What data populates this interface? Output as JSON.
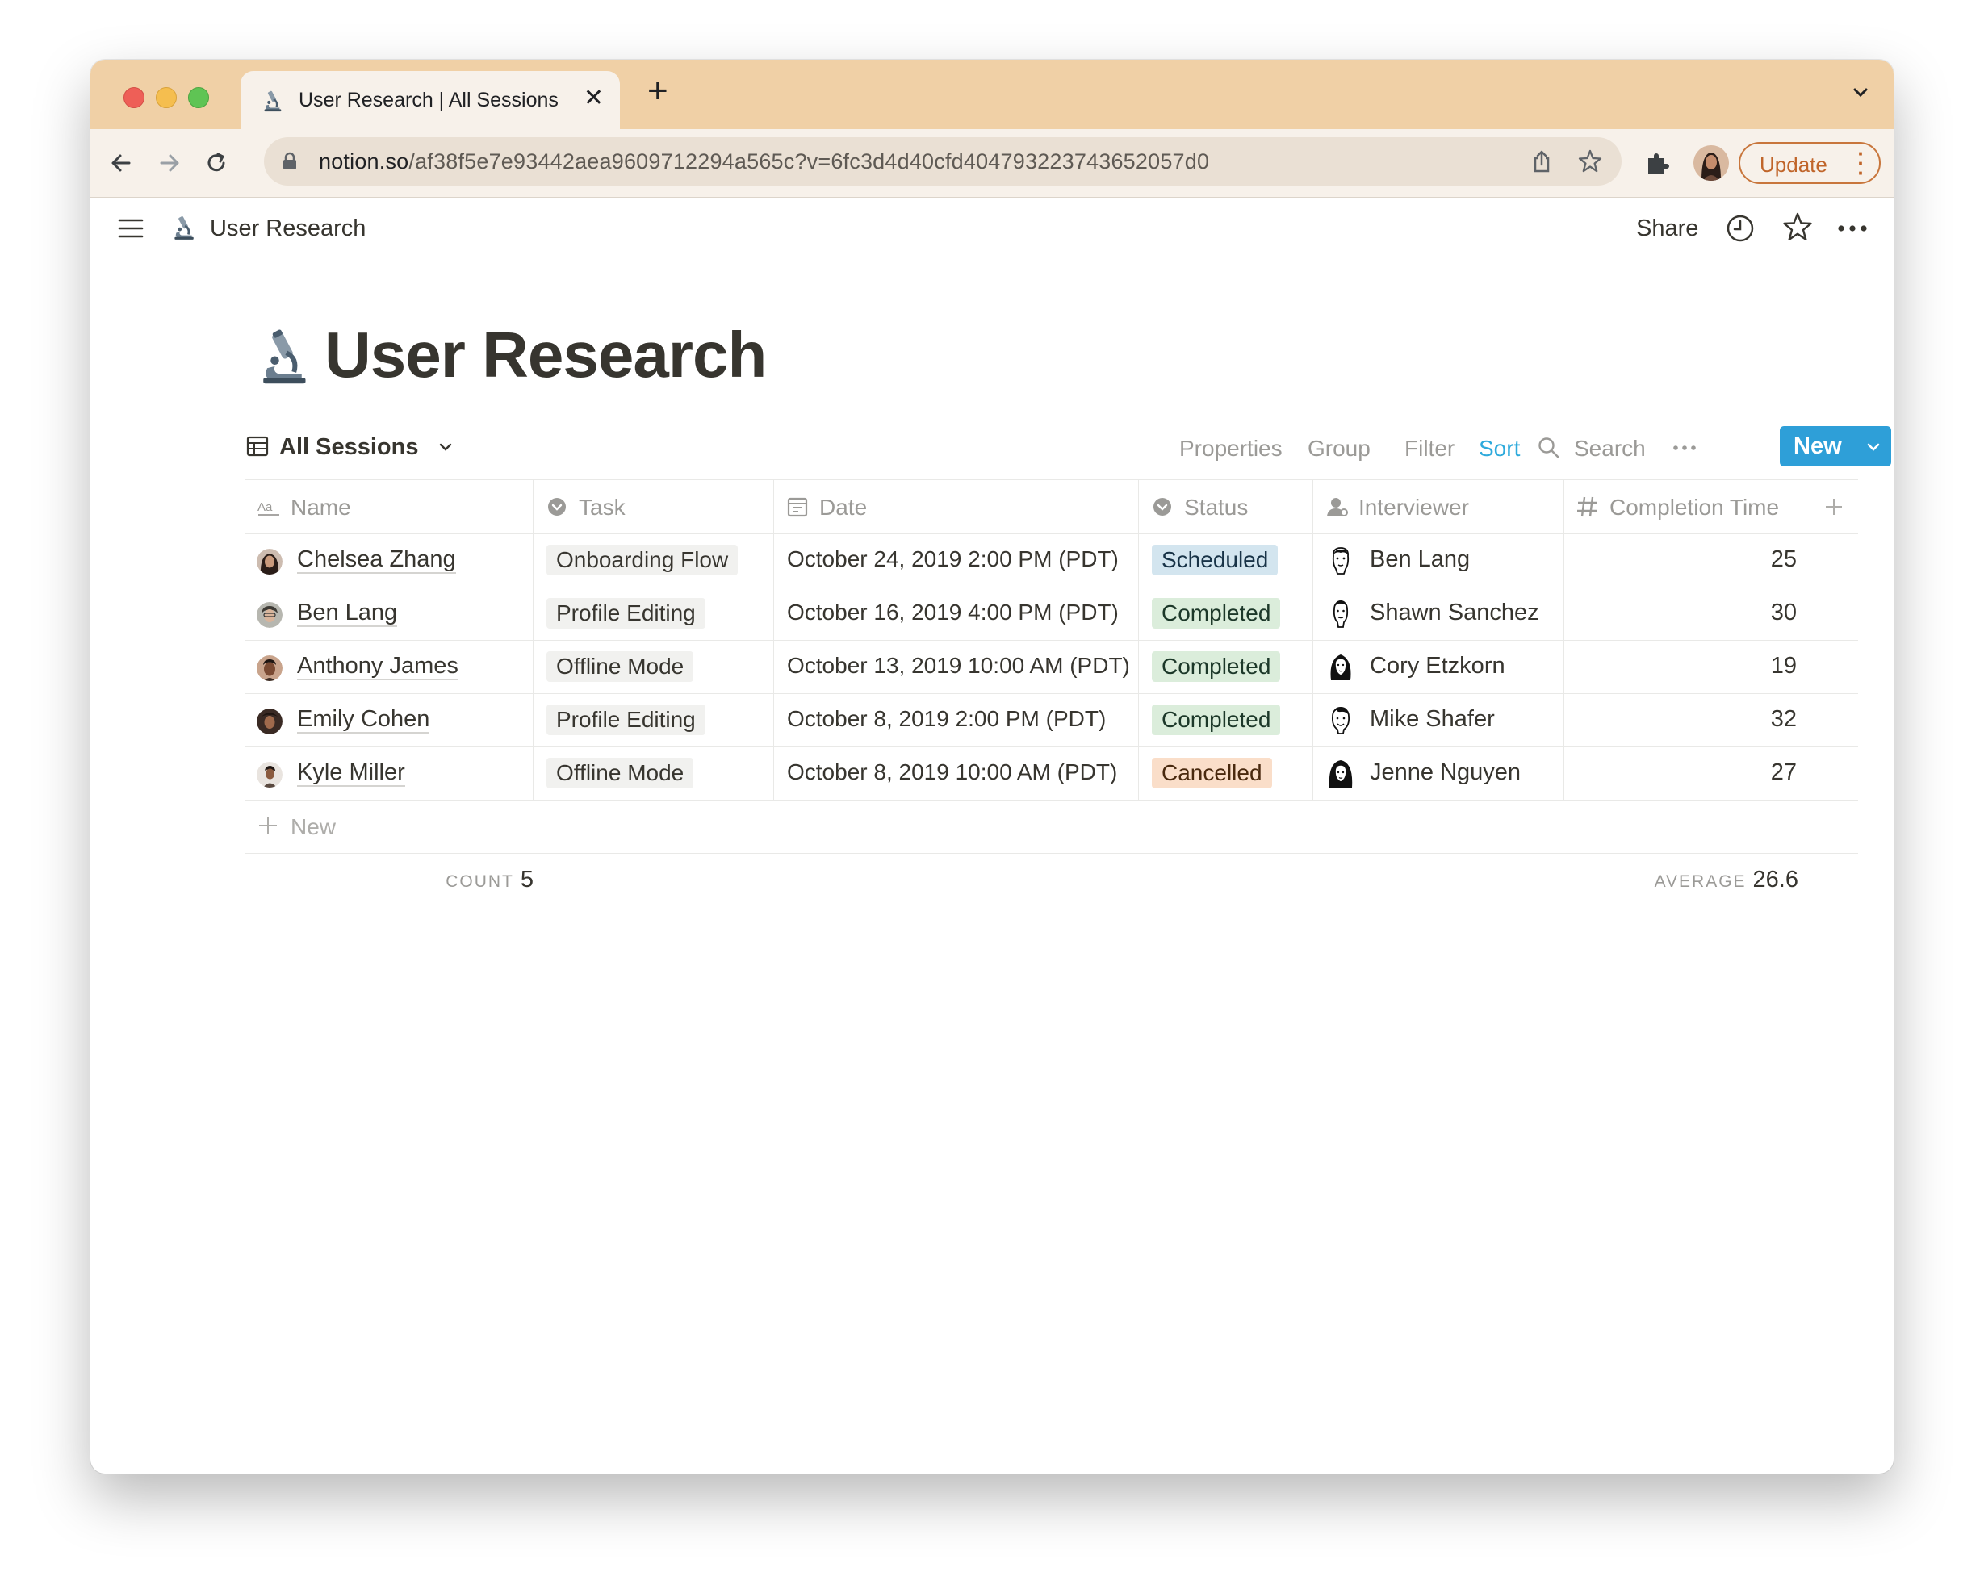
{
  "browser": {
    "tab_title": "User Research | All Sessions",
    "url_host": "notion.so",
    "url_path": "/af38f5e7e93442aea9609712294a565c?v=6fc3d4d40cfd404793223743652057d0",
    "update_label": "Update"
  },
  "topbar": {
    "breadcrumb": "User Research",
    "share_label": "Share"
  },
  "page": {
    "title": "User Research",
    "icon": "microscope-icon"
  },
  "view": {
    "name": "All Sessions",
    "buttons": {
      "properties": "Properties",
      "group": "Group",
      "filter": "Filter",
      "sort": "Sort",
      "search": "Search",
      "new": "New"
    }
  },
  "table": {
    "columns": [
      {
        "label": "Name",
        "icon": "text-property-icon"
      },
      {
        "label": "Task",
        "icon": "select-property-icon"
      },
      {
        "label": "Date",
        "icon": "calendar-icon"
      },
      {
        "label": "Status",
        "icon": "select-property-icon"
      },
      {
        "label": "Interviewer",
        "icon": "person-property-icon"
      },
      {
        "label": "Completion Time",
        "icon": "number-property-icon"
      }
    ],
    "rows": [
      {
        "name": "Chelsea Zhang",
        "task": "Onboarding Flow",
        "date": "October 24, 2019 2:00 PM (PDT)",
        "status": "Scheduled",
        "interviewer": "Ben Lang",
        "completion_time": "25"
      },
      {
        "name": "Ben Lang",
        "task": "Profile Editing",
        "date": "October 16, 2019 4:00 PM (PDT)",
        "status": "Completed",
        "interviewer": "Shawn Sanchez",
        "completion_time": "30"
      },
      {
        "name": "Anthony James",
        "task": "Offline Mode",
        "date": "October 13, 2019 10:00 AM (PDT)",
        "status": "Completed",
        "interviewer": "Cory Etzkorn",
        "completion_time": "19"
      },
      {
        "name": "Emily Cohen",
        "task": "Profile Editing",
        "date": "October 8, 2019 2:00 PM (PDT)",
        "status": "Completed",
        "interviewer": "Mike Shafer",
        "completion_time": "32"
      },
      {
        "name": "Kyle Miller",
        "task": "Offline Mode",
        "date": "October 8, 2019 10:00 AM (PDT)",
        "status": "Cancelled",
        "interviewer": "Jenne Nguyen",
        "completion_time": "27"
      }
    ],
    "new_row_label": "New",
    "footer": {
      "count_label": "COUNT",
      "count_value": "5",
      "average_label": "AVERAGE",
      "average_value": "26.6"
    }
  },
  "help_label": "?",
  "colors": {
    "accent": "#2e9fd8",
    "tabstrip": "#f0d0a6",
    "status_scheduled": "#d3e5ef",
    "status_completed": "#dbeddb",
    "status_cancelled": "#fadec9"
  }
}
